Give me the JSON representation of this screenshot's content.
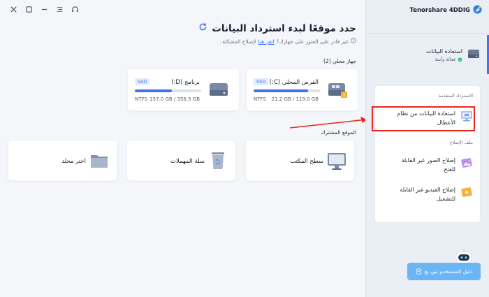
{
  "window": {
    "controls": [
      "headset-icon",
      "menu-icon",
      "minimize-icon",
      "maximize-icon",
      "close-icon"
    ]
  },
  "header": {
    "title": "حدد موقعًا لبدء استرداد البيانات",
    "subtitle_prefix": "غير قادر على العثور على جهازك؟",
    "subtitle_link": "انقر هنا",
    "subtitle_suffix": "لإصلاح المشكلة."
  },
  "local_devices": {
    "label": "جهاز محلي (2)",
    "drives": [
      {
        "name": "القرص المحلي (C:)",
        "type": "SSD",
        "fs": "NTFS",
        "size": "21.2 GB / 119.0 GB",
        "used_fraction": 0.82,
        "warning": true
      },
      {
        "name": "برنامج (D:)",
        "type": "SSD",
        "fs": "NTFS",
        "size": "157.0 GB / 356.5 GB",
        "used_fraction": 0.56,
        "warning": false
      }
    ]
  },
  "shared_locations": {
    "label": "الموقع المشترك",
    "items": [
      {
        "label": "سطح المكتب",
        "icon": "desktop-icon"
      },
      {
        "label": "سلة المهملات",
        "icon": "recycle-bin-icon"
      },
      {
        "label": "اختر مجلد",
        "icon": "folder-icon"
      }
    ]
  },
  "sidebar": {
    "brand": "Tenorshare 4DDIG",
    "data_recovery": {
      "label": "استعادة البيانات",
      "sub": "فعالة وآمنة"
    },
    "advanced_section": "الاسترداد المتقدمة",
    "crash_recovery": "استعادة البيانات من نظام الأعطال",
    "repair_section": "ملف الإصلاح",
    "photo_repair": "إصلاح الصور غير القابلة للفتح",
    "video_repair": "إصلاح الفيديو غير القابلة للتشغيل",
    "guide_button": "دليل المستخدم نبي بع"
  },
  "colors": {
    "accent": "#3f73f0",
    "highlight": "#e8261c",
    "guide": "#6ab6f5"
  }
}
